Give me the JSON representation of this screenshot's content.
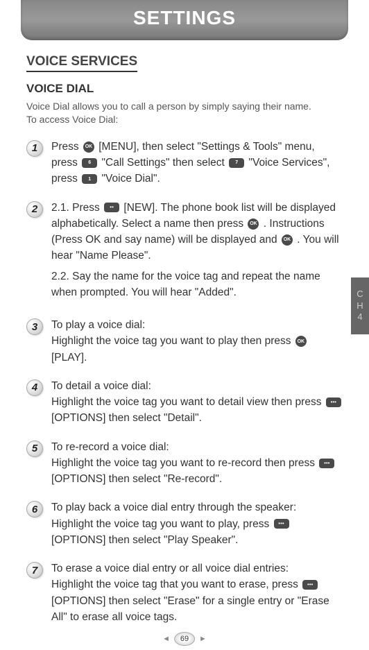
{
  "header": {
    "title": "SETTINGS"
  },
  "section": {
    "title": "VOICE SERVICES"
  },
  "subsection": {
    "title": "VOICE DIAL"
  },
  "intro": {
    "line1": "Voice Dial allows you to call a person by simply saying their name.",
    "line2": "To access Voice Dial:"
  },
  "steps": {
    "s1": {
      "num": "1",
      "t1": "Press ",
      "t2": " [MENU], then select \"Settings & Tools\" menu, press ",
      "t3": " \"Call Settings\" then select ",
      "t4": " \"Voice Services\", press ",
      "t5": " \"Voice Dial\"."
    },
    "s2": {
      "num": "2",
      "a_label": "2.1. ",
      "a_t1": "Press ",
      "a_t2": " [NEW]. The phone book list will be displayed alphabetically. Select a name then press ",
      "a_t3": " . Instructions (Press OK and say name) will be displayed and ",
      "a_t4": " . You will hear \"Name Please\".",
      "b_label": "2.2. ",
      "b_t1": "Say the name for the voice tag and repeat the name when prompted. You will hear \"Added\"."
    },
    "s3": {
      "num": "3",
      "t1": "To play a voice dial:",
      "t2": "Highlight the voice tag you want to play then press ",
      "t3": " [PLAY]."
    },
    "s4": {
      "num": "4",
      "t1": "To detail a voice dial:",
      "t2": "Highlight the voice tag you want to detail view then press ",
      "t3": " [OPTIONS] then select \"Detail\"."
    },
    "s5": {
      "num": "5",
      "t1": "To re-record a voice dial:",
      "t2": "Highlight the voice tag you want to re-record then press ",
      "t3": " [OPTIONS] then select \"Re-record\"."
    },
    "s6": {
      "num": "6",
      "t1": "To play back a voice dial entry through the speaker:",
      "t2": "Highlight the voice tag you want to play, press ",
      "t3": " [OPTIONS] then select \"Play Speaker\"."
    },
    "s7": {
      "num": "7",
      "t1": "To erase a voice dial entry or all voice dial entries:",
      "t2": "Highlight the voice tag that you want to erase, press ",
      "t3": " [OPTIONS] then select \"Erase\" for a single entry or \"Erase All\" to erase all voice tags."
    }
  },
  "sidetab": {
    "l1": "C",
    "l2": "H",
    "l3": "4"
  },
  "keys": {
    "ok": "OK",
    "six": "6",
    "seven": "7",
    "one": "1"
  },
  "footer": {
    "page": "69"
  }
}
